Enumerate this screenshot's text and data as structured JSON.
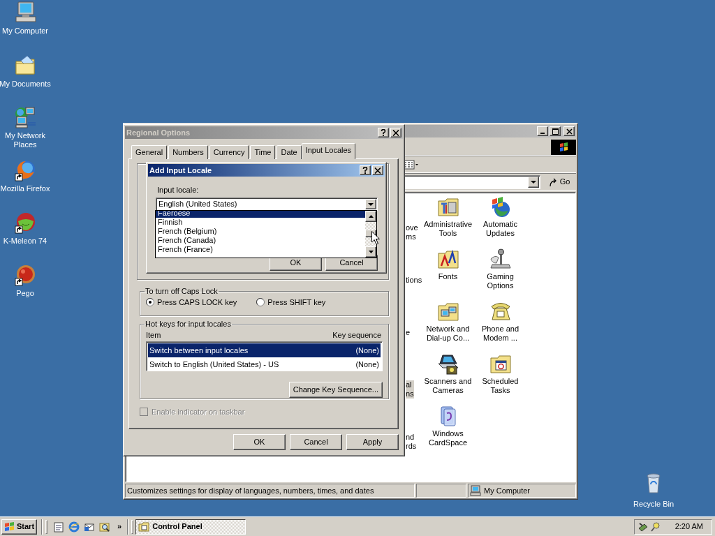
{
  "desktop": {
    "icons": [
      {
        "label": "My Computer"
      },
      {
        "label": "My Documents"
      },
      {
        "label": "My Network Places"
      },
      {
        "label": "Mozilla Firefox"
      },
      {
        "label": "K-Meleon 74"
      },
      {
        "label": "Pego"
      }
    ],
    "recycle_bin": {
      "label": "Recycle Bin"
    }
  },
  "control_panel": {
    "go": "Go",
    "rows": [
      {
        "cut_off_lines": [
          "ove",
          "ms"
        ],
        "cut_off_selected": false,
        "items": [
          {
            "label": "Administrative Tools"
          },
          {
            "label": "Automatic Updates"
          }
        ]
      },
      {
        "cut_off_lines": [
          "tions"
        ],
        "cut_off_selected": false,
        "items": [
          {
            "label": "Fonts"
          },
          {
            "label": "Gaming Options"
          }
        ]
      },
      {
        "cut_off_lines": [
          "e"
        ],
        "cut_off_selected": false,
        "items": [
          {
            "label": "Network and Dial-up Co..."
          },
          {
            "label": "Phone and Modem ..."
          }
        ]
      },
      {
        "cut_off_lines": [
          "al",
          "ns"
        ],
        "cut_off_selected": true,
        "items": [
          {
            "label": "Scanners and Cameras"
          },
          {
            "label": "Scheduled Tasks"
          }
        ]
      },
      {
        "cut_off_lines": [
          "nd",
          "rds"
        ],
        "cut_off_selected": false,
        "items": [
          {
            "label": "Windows CardSpace"
          }
        ]
      }
    ],
    "status_bar": {
      "text": "Customizes settings for display of languages, numbers, times, and dates",
      "zone": "My Computer"
    }
  },
  "regional_options": {
    "title": "Regional Options",
    "tabs": [
      {
        "label": "General",
        "selected": false
      },
      {
        "label": "Numbers",
        "selected": false
      },
      {
        "label": "Currency",
        "selected": false
      },
      {
        "label": "Time",
        "selected": false
      },
      {
        "label": "Date",
        "selected": false
      },
      {
        "label": "Input Locales",
        "selected": true
      }
    ],
    "caps_lock": {
      "title": "To turn off Caps Lock",
      "options": [
        {
          "label": "Press CAPS LOCK key",
          "selected": true
        },
        {
          "label": "Press SHIFT key",
          "selected": false
        }
      ]
    },
    "hot_keys": {
      "title": "Hot keys for input locales",
      "columns": [
        "Item",
        "Key sequence"
      ],
      "rows": [
        {
          "item": "Switch between input locales",
          "key_sequence": "(None)",
          "selected": true
        },
        {
          "item": "Switch to English (United States) - US",
          "key_sequence": "(None)",
          "selected": false
        }
      ],
      "change_button": "Change Key Sequence..."
    },
    "taskbar_indicator": {
      "label": "Enable indicator on taskbar",
      "checked": false,
      "disabled": true
    },
    "buttons": [
      "OK",
      "Cancel",
      "Apply"
    ]
  },
  "add_input_locale": {
    "title": "Add Input Locale",
    "field_label": "Input locale:",
    "value": "English (United States)",
    "options": [
      {
        "label": "Faeroese",
        "selected": true
      },
      {
        "label": "Finnish",
        "selected": false
      },
      {
        "label": "French (Belgium)",
        "selected": false
      },
      {
        "label": "French (Canada)",
        "selected": false
      },
      {
        "label": "French (France)",
        "selected": false
      }
    ],
    "buttons": [
      "OK",
      "Cancel"
    ]
  },
  "taskbar": {
    "start": "Start",
    "more": "»",
    "tasks": [
      {
        "label": "Control Panel",
        "selected": true
      }
    ],
    "clock": "2:20 AM"
  }
}
